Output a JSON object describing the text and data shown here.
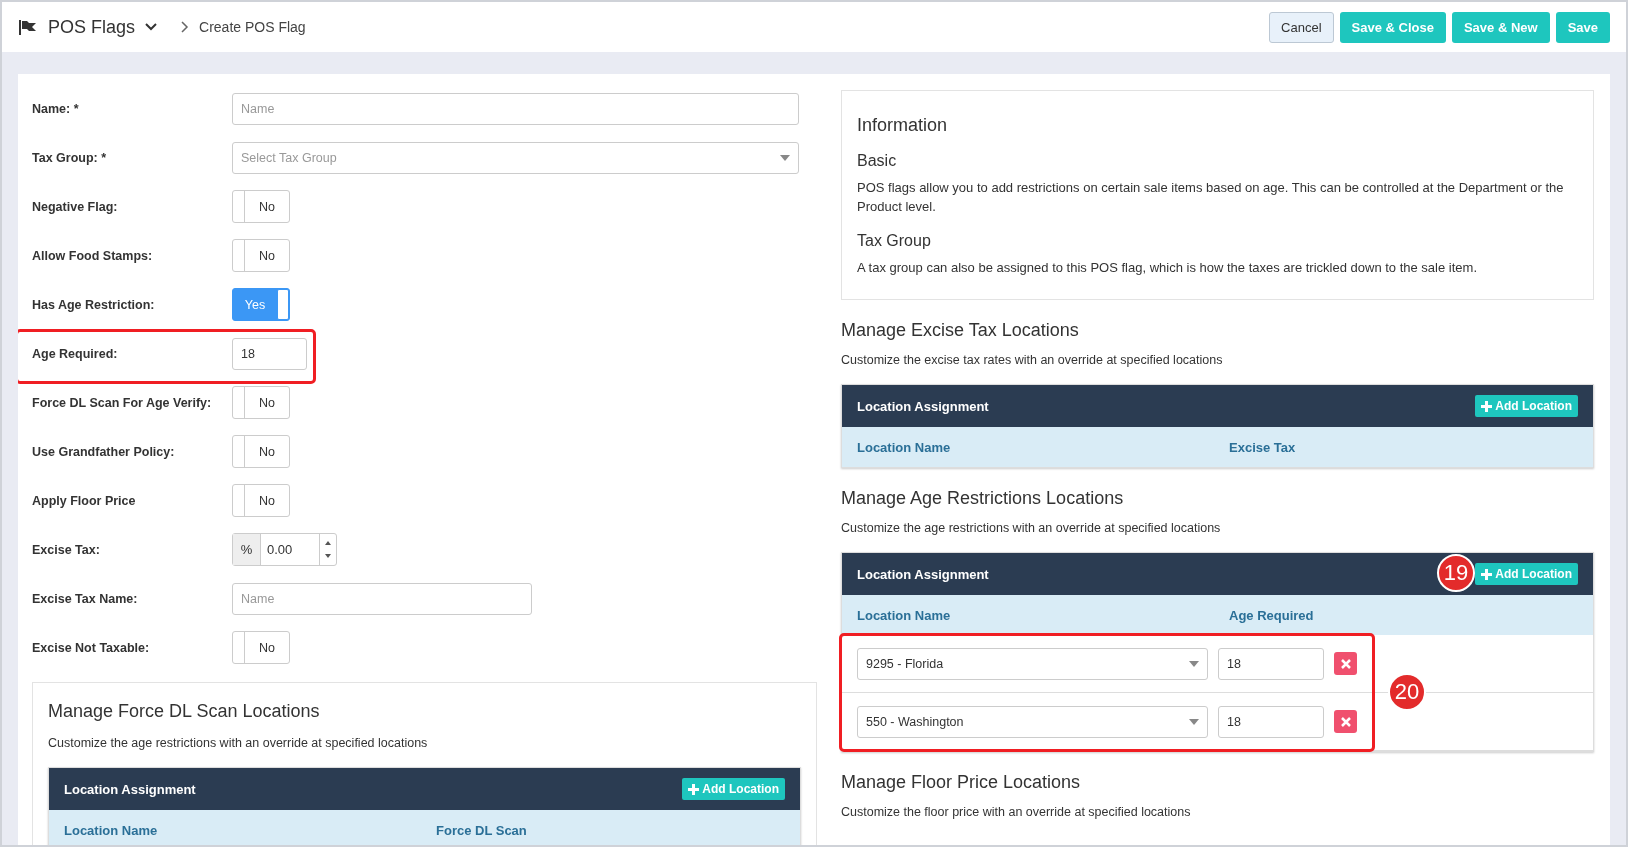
{
  "header": {
    "title": "POS Flags",
    "breadcrumb": "Create POS Flag",
    "buttons": [
      {
        "label": "Cancel",
        "kind": "secondary"
      },
      {
        "label": "Save & Close",
        "kind": "primary"
      },
      {
        "label": "Save & New",
        "kind": "primary"
      },
      {
        "label": "Save",
        "kind": "primary"
      }
    ]
  },
  "form": [
    {
      "label": "Name: *",
      "kind": "text",
      "placeholder": "Name"
    },
    {
      "label": "Tax Group: *",
      "kind": "select",
      "placeholder": "Select Tax Group"
    },
    {
      "label": "Negative Flag:",
      "kind": "toggle",
      "on": false,
      "text": "No"
    },
    {
      "label": "Allow Food Stamps:",
      "kind": "toggle",
      "on": false,
      "text": "No"
    },
    {
      "label": "Has Age Restriction:",
      "kind": "toggle",
      "on": true,
      "text": "Yes"
    },
    {
      "label": "Age Required:",
      "kind": "short",
      "value": "18",
      "highlighted": true
    },
    {
      "label": "Force DL Scan For Age Verify:",
      "kind": "toggle",
      "on": false,
      "text": "No"
    },
    {
      "label": "Use Grandfather Policy:",
      "kind": "toggle",
      "on": false,
      "text": "No"
    },
    {
      "label": "Apply Floor Price",
      "kind": "toggle",
      "on": false,
      "text": "No"
    },
    {
      "label": "Excise Tax:",
      "kind": "percent",
      "addon": "%",
      "value": "0.00"
    },
    {
      "label": "Excise Tax Name:",
      "kind": "medium",
      "placeholder": "Name"
    },
    {
      "label": "Excise Not Taxable:",
      "kind": "toggle",
      "on": false,
      "text": "No"
    }
  ],
  "information": {
    "title": "Information",
    "sections": [
      {
        "heading": "Basic",
        "text": "POS flags allow you to add restrictions on certain sale items based on age. This can be controlled at the Department or the Product level."
      },
      {
        "heading": "Tax Group",
        "text": "A tax group can also be assigned to this POS flag, which is how the taxes are trickled down to the sale item."
      }
    ]
  },
  "left_sections": [
    {
      "title": "Manage Force DL Scan Locations",
      "description": "Customize the age restrictions with an override at specified locations",
      "panel_title": "Location Assignment",
      "add_button": "Add Location",
      "columns": [
        "Location Name",
        "Force DL Scan"
      ]
    }
  ],
  "right_sections": [
    {
      "title": "Manage Excise Tax Locations",
      "description": "Customize the excise tax rates with an override at specified locations",
      "panel_title": "Location Assignment",
      "add_button": "Add Location",
      "columns": [
        "Location Name",
        "Excise Tax"
      ]
    },
    {
      "title": "Manage Age Restrictions Locations",
      "description": "Customize the age restrictions with an override at specified locations",
      "panel_title": "Location Assignment",
      "add_button": "Add Location",
      "callout": "19",
      "rows_callout": "20",
      "rows_highlighted": true,
      "columns": [
        "Location Name",
        "Age Required"
      ],
      "rows": [
        {
          "location": "9295 - Florida",
          "age": "18"
        },
        {
          "location": "550 - Washington",
          "age": "18"
        }
      ]
    },
    {
      "title": "Manage Floor Price Locations",
      "description": "Customize the floor price with an override at specified locations"
    }
  ]
}
